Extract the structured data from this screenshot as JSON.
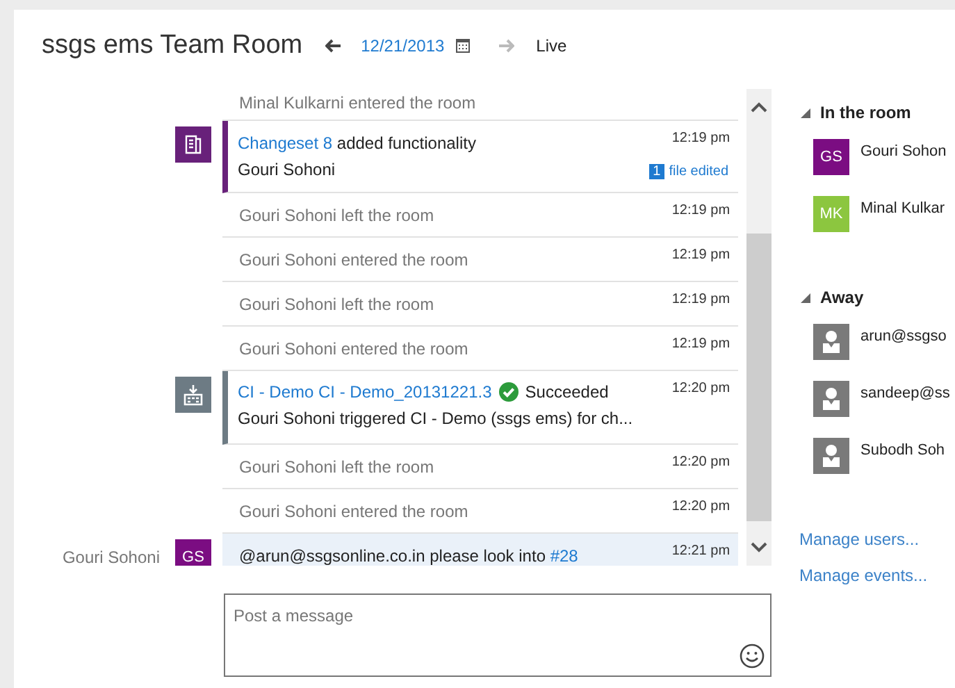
{
  "header": {
    "title": "ssgs ems Team Room",
    "date": "12/21/2013",
    "live": "Live"
  },
  "feed": {
    "messages": [
      {
        "kind": "event",
        "text": "Minal Kulkarni entered the room"
      },
      {
        "kind": "changeset",
        "link": "Changeset 8",
        "text": " added functionality",
        "author": "Gouri Sohoni",
        "time": "12:19 pm",
        "badge_count": "1",
        "badge_text": "file edited"
      },
      {
        "kind": "event",
        "text": "Gouri Sohoni left the room",
        "time": "12:19 pm"
      },
      {
        "kind": "event",
        "text": "Gouri Sohoni entered the room",
        "time": "12:19 pm"
      },
      {
        "kind": "event",
        "text": "Gouri Sohoni left the room",
        "time": "12:19 pm"
      },
      {
        "kind": "event",
        "text": "Gouri Sohoni entered the room",
        "time": "12:19 pm"
      },
      {
        "kind": "build",
        "link": "CI - Demo CI - Demo_20131221.3",
        "status": "Succeeded",
        "text": "Gouri Sohoni triggered CI - Demo (ssgs ems) for ch...",
        "time": "12:20 pm"
      },
      {
        "kind": "event",
        "text": "Gouri Sohoni left the room",
        "time": "12:20 pm"
      },
      {
        "kind": "event",
        "text": "Gouri Sohoni entered the room",
        "time": "12:20 pm"
      },
      {
        "kind": "chat",
        "author": "Gouri Sohoni",
        "initials": "GS",
        "color": "#7b0d82",
        "text": "@arun@ssgsonline.co.in please look into",
        "link": "#28",
        "time": "12:21 pm"
      }
    ]
  },
  "composer": {
    "placeholder": "Post a message"
  },
  "sidebar": {
    "groups": [
      {
        "title": "In the room",
        "expanded": true,
        "members": [
          {
            "kind": "initials",
            "initials": "GS",
            "name": "Gouri Sohon",
            "color": "#7b0d82"
          },
          {
            "kind": "initials",
            "initials": "MK",
            "name": "Minal Kulkar",
            "color": "#8cc63f"
          }
        ]
      },
      {
        "title": "Away",
        "expanded": true,
        "members": [
          {
            "kind": "generic",
            "name": "arun@ssgso"
          },
          {
            "kind": "generic",
            "name": "sandeep@ss"
          },
          {
            "kind": "generic",
            "name": "Subodh Soh"
          }
        ]
      }
    ],
    "links": [
      "Manage users...",
      "Manage events..."
    ]
  }
}
